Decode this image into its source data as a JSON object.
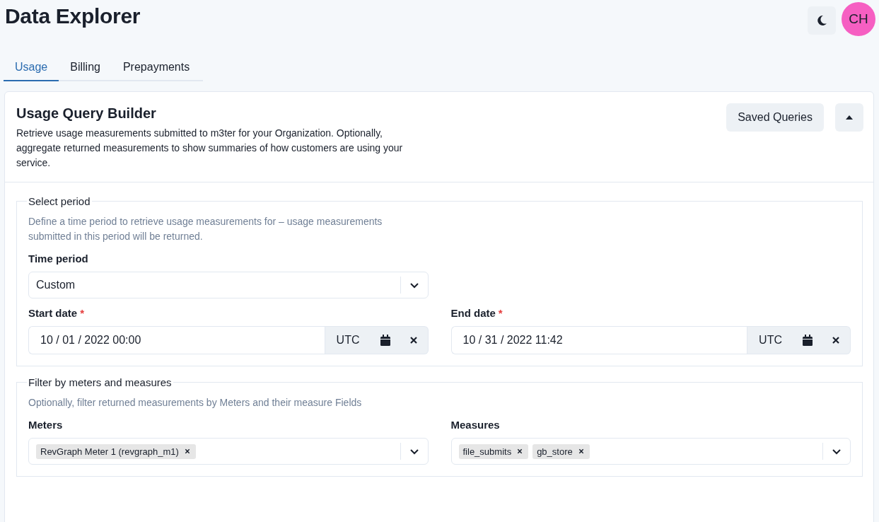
{
  "header": {
    "title": "Data Explorer",
    "avatar": "CH"
  },
  "tabs": [
    {
      "label": "Usage",
      "selected": true
    },
    {
      "label": "Billing",
      "selected": false
    },
    {
      "label": "Prepayments",
      "selected": false
    }
  ],
  "card": {
    "title": "Usage Query Builder",
    "description": "Retrieve usage measurements submitted to m3ter for your Organization. Optionally, aggregate returned measurements to show summaries of how customers are using your service.",
    "saved_queries_button": "Saved Queries",
    "expanded": true
  },
  "sections": [
    {
      "legend": "Select period",
      "hint": "Define a time period to retrieve usage measurements for – usage measurements submitted in this period will be returned.",
      "rows": [
        {
          "fields": [
            {
              "kind": "select",
              "label": "Time period",
              "value": "Custom"
            }
          ]
        },
        {
          "fields": [
            {
              "kind": "date",
              "label": "Start date",
              "required_mark": "*",
              "value": "10 / 01 / 2022 00:00",
              "timezone": "UTC"
            },
            {
              "kind": "date",
              "label": "End date",
              "required_mark": "*",
              "value": "10 / 31 / 2022 11:42",
              "timezone": "UTC"
            }
          ]
        }
      ]
    },
    {
      "legend": "Filter by meters and measures",
      "hint": "Optionally, filter returned measurements by Meters and their measure Fields",
      "rows": [
        {
          "fields": [
            {
              "kind": "multiselect",
              "label": "Meters",
              "tags": [
                "RevGraph Meter 1 (revgraph_m1)"
              ]
            },
            {
              "kind": "multiselect",
              "label": "Measures",
              "tags": [
                "file_submits",
                "gb_store"
              ]
            }
          ]
        }
      ]
    }
  ]
}
